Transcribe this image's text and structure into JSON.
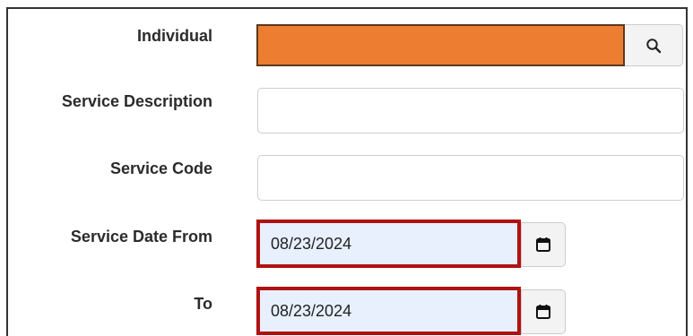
{
  "form": {
    "individual": {
      "label": "Individual",
      "value": "",
      "highlight_color": "#ed7d31"
    },
    "service_description": {
      "label": "Service Description",
      "value": ""
    },
    "service_code": {
      "label": "Service Code",
      "value": ""
    },
    "service_date_from": {
      "label": "Service Date From",
      "value": "08/23/2024"
    },
    "service_date_to": {
      "label": "To",
      "value": "08/23/2024"
    }
  },
  "icons": {
    "search": "search-icon",
    "calendar": "calendar-icon"
  },
  "colors": {
    "date_highlight_border": "#b01212",
    "date_field_bg": "#e8f0fe"
  }
}
